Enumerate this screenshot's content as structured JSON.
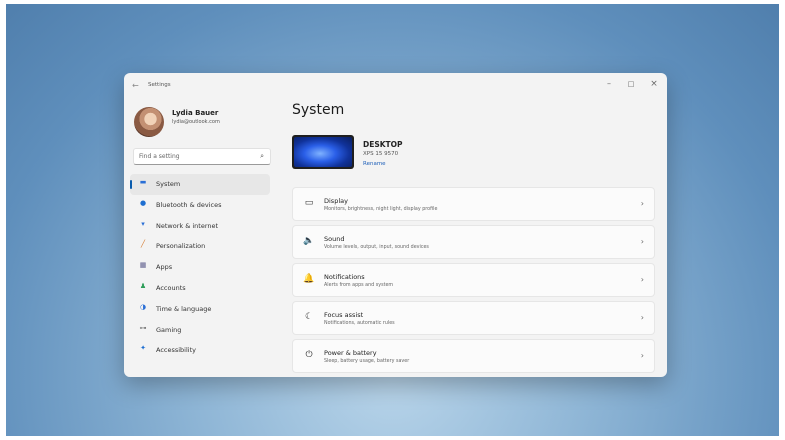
{
  "window": {
    "title": "Settings",
    "back_glyph": "←",
    "min_glyph": "–",
    "max_glyph": "□",
    "close_glyph": "×"
  },
  "user": {
    "name": "Lydia Bauer",
    "email": "lydia@outlook.com"
  },
  "search": {
    "placeholder": "Find a setting",
    "icon": "search-icon",
    "glyph": "⌕"
  },
  "nav": {
    "items": [
      {
        "label": "System",
        "icon": "monitor-icon",
        "glyph": "▬",
        "color": "#2a6fd6",
        "selected": true
      },
      {
        "label": "Bluetooth & devices",
        "icon": "bluetooth-icon",
        "glyph": "●",
        "color": "#1f6fd1"
      },
      {
        "label": "Network & internet",
        "icon": "wifi-icon",
        "glyph": "▾",
        "color": "#2a6fd6"
      },
      {
        "label": "Personalization",
        "icon": "brush-icon",
        "glyph": "╱",
        "color": "#d4782b"
      },
      {
        "label": "Apps",
        "icon": "apps-icon",
        "glyph": "▦",
        "color": "#5a5a8a"
      },
      {
        "label": "Accounts",
        "icon": "person-icon",
        "glyph": "♟",
        "color": "#2f9e5a"
      },
      {
        "label": "Time & language",
        "icon": "globe-clock-icon",
        "glyph": "◑",
        "color": "#2a6fd6"
      },
      {
        "label": "Gaming",
        "icon": "controller-icon",
        "glyph": "⊶",
        "color": "#6a6a6a"
      },
      {
        "label": "Accessibility",
        "icon": "accessibility-icon",
        "glyph": "✦",
        "color": "#1f6fd1"
      }
    ]
  },
  "main": {
    "title": "System",
    "device": {
      "name": "DESKTOP",
      "model": "XPS 15 9570",
      "rename": "Rename"
    },
    "cards": [
      {
        "title": "Display",
        "subtitle": "Monitors, brightness, night light, display profile",
        "icon": "display-icon",
        "glyph": "▭"
      },
      {
        "title": "Sound",
        "subtitle": "Volume levels, output, input, sound devices",
        "icon": "speaker-icon",
        "glyph": "🔈"
      },
      {
        "title": "Notifications",
        "subtitle": "Alerts from apps and system",
        "icon": "bell-icon",
        "glyph": "🔔"
      },
      {
        "title": "Focus assist",
        "subtitle": "Notifications, automatic rules",
        "icon": "moon-icon",
        "glyph": "☾"
      },
      {
        "title": "Power & battery",
        "subtitle": "Sleep, battery usage, battery saver",
        "icon": "power-icon",
        "glyph": "⏻"
      }
    ],
    "chevron": "›"
  }
}
